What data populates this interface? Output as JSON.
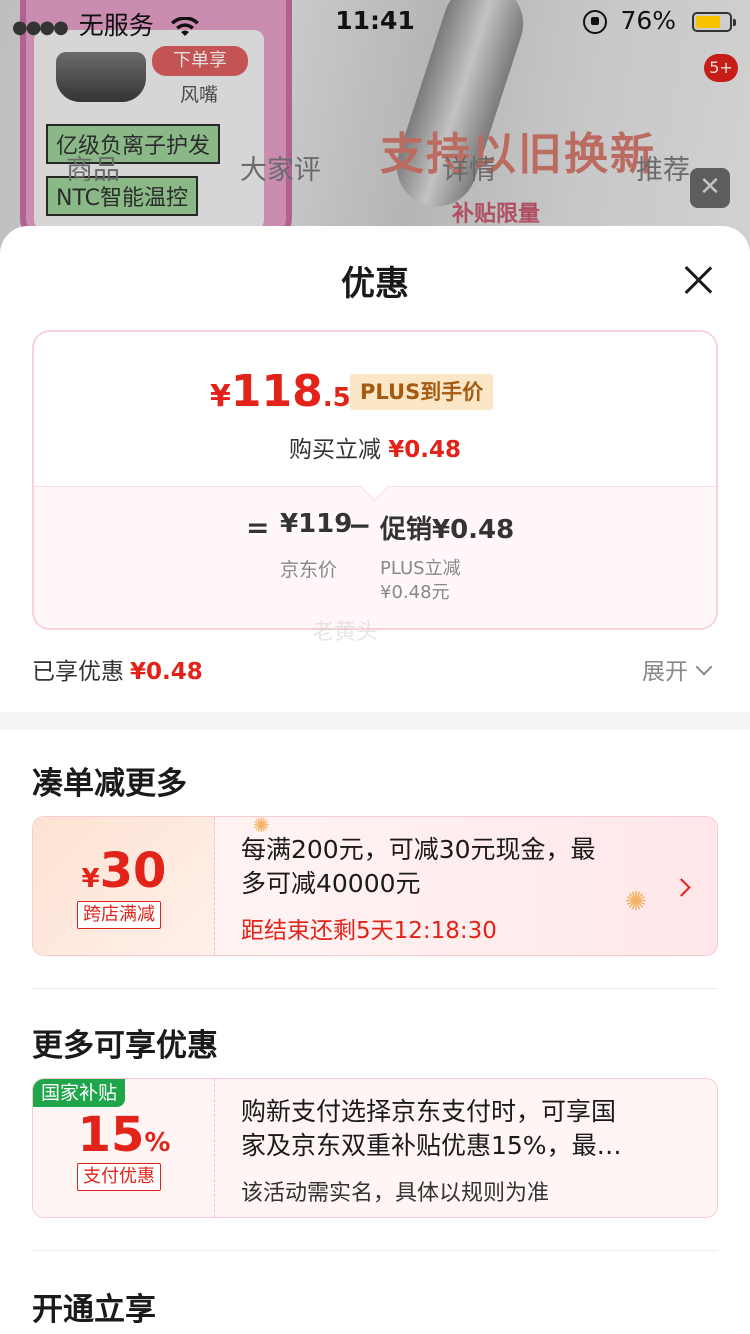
{
  "status_bar": {
    "carrier": "无服务",
    "time": "11:41",
    "battery_percent": "76%",
    "battery_level": 0.76
  },
  "background": {
    "tabs": [
      "商品",
      "大家评",
      "详情",
      "推荐"
    ],
    "promo_tag": "下单享",
    "promo_sub": "风嘴",
    "chip1": "亿级负离子护发",
    "chip2": "NTC智能温控",
    "banner": "支持以旧换新",
    "banner_sub": "补贴限量",
    "cart_badge": "5+"
  },
  "sheet": {
    "title": "优惠",
    "price_card": {
      "currency": "¥",
      "price_int": "118",
      "price_dec": ".52",
      "plus_tag": "PLUS到手价",
      "reduce_label": "购买立减",
      "reduce_value": "¥0.48",
      "equals": "=",
      "jd_price": "¥119",
      "minus": "−",
      "promo_value": "促销¥0.48",
      "jd_price_label": "京东价",
      "plus_reduce_label": "PLUS立减",
      "plus_reduce_value": "¥0.48元"
    },
    "watermark": "老黄头",
    "enjoyed_label": "已享优惠",
    "enjoyed_value": "¥0.48",
    "expand_label": "展开",
    "section1": {
      "title": "凑单减更多",
      "coupon": {
        "currency": "¥",
        "amount": "30",
        "tag": "跨店满减",
        "desc_line1": "每满200元，可减30元现金，最",
        "desc_line2": "多可减40000元",
        "countdown": "距结束还剩5天12:18:30"
      }
    },
    "section2": {
      "title": "更多可享优惠",
      "coupon": {
        "corner_tag": "国家补贴",
        "amount": "15",
        "unit": "%",
        "tag": "支付优惠",
        "desc_line1": "购新支付选择京东支付时，可享国",
        "desc_line2": "家及京东双重补贴优惠15%，最…",
        "note": "该活动需实名，具体以规则为准"
      }
    },
    "section3": {
      "title": "开通立享"
    }
  },
  "colors": {
    "accent_red": "#e2231a",
    "plus_gold_bg": "#fbe7c6",
    "plus_gold_text": "#a55a12",
    "national_green": "#1fa64a"
  }
}
